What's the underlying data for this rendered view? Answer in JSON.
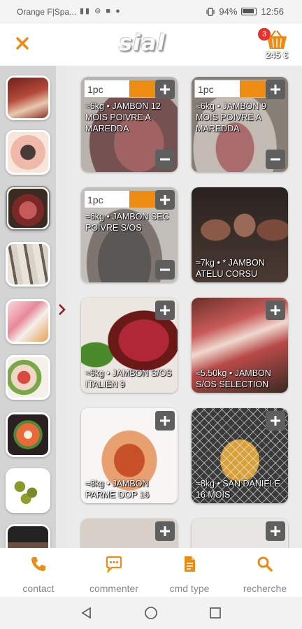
{
  "status_bar": {
    "carrier": "Orange F|Spa...",
    "signal_icons": "▮▮ ⊚ ■ ●",
    "vibrate_icon": "vibrate-icon",
    "battery_percent": "94%",
    "battery_level": 0.94,
    "time": "12:56"
  },
  "header": {
    "close_icon": "close-icon",
    "logo_text": "sial",
    "cart_icon": "basket-icon",
    "cart_count": "3",
    "cart_total": "245 €",
    "accent_color": "#ee8b12"
  },
  "sidebar": {
    "categories": [
      {
        "icon": "category-thumbnail",
        "active": false
      },
      {
        "icon": "category-thumbnail",
        "active": false
      },
      {
        "icon": "category-thumbnail",
        "active": true
      },
      {
        "icon": "category-thumbnail",
        "active": false
      },
      {
        "icon": "category-thumbnail",
        "active": false
      },
      {
        "icon": "category-thumbnail",
        "active": false
      },
      {
        "icon": "category-thumbnail",
        "active": false
      },
      {
        "icon": "category-thumbnail",
        "active": false
      },
      {
        "icon": "category-thumbnail",
        "active": false
      }
    ],
    "arrow_icon": "chevron-right-icon"
  },
  "products": [
    {
      "name": "≈6kg • JAMBON 12 MOIS POIVRE A MAREDDA",
      "qty": "1pc",
      "in_cart": true
    },
    {
      "name": "≈6kg • JAMBON 9 MOIS POIVRE A MAREDDA",
      "qty": "1pc",
      "in_cart": true
    },
    {
      "name": "≈6kg • JAMBON SEC POIVRE S/OS",
      "qty": "1pc",
      "in_cart": true
    },
    {
      "name": "≈7kg • * JAMBON ATELU CORSU",
      "qty": "",
      "in_cart": false
    },
    {
      "name": "≈6kg • JAMBON S/OS ITALIEN 9",
      "qty": "",
      "in_cart": false
    },
    {
      "name": "≈5.50kg • JAMBON S/OS SELECTION",
      "qty": "",
      "in_cart": false
    },
    {
      "name": "≈8kg • JAMBON PARME DOP 16",
      "qty": "",
      "in_cart": false
    },
    {
      "name": "≈8kg • SAN DANIELE 16 MOIS",
      "qty": "",
      "in_cart": false
    },
    {
      "name": "",
      "qty": "",
      "in_cart": false
    },
    {
      "name": "",
      "qty": "",
      "in_cart": false
    }
  ],
  "bottom_nav": {
    "items": [
      {
        "label": "contact",
        "icon": "phone-icon"
      },
      {
        "label": "commenter",
        "icon": "chat-icon"
      },
      {
        "label": "cmd type",
        "icon": "document-icon"
      },
      {
        "label": "recherche",
        "icon": "search-icon"
      }
    ]
  },
  "system_nav": {
    "back_icon": "back-icon",
    "home_icon": "home-icon",
    "recents_icon": "recents-icon"
  }
}
